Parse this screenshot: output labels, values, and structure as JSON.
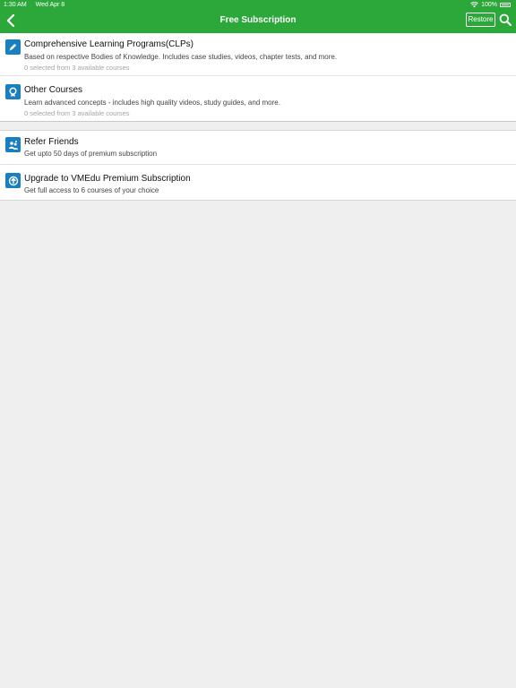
{
  "status_bar": {
    "time": "1:30 AM",
    "date": "Wed Apr 8",
    "battery": "100%"
  },
  "navbar": {
    "title": "Free Subscription",
    "restore_label": "Restore",
    "back_icon": "chevron-left-icon",
    "search_icon": "search-icon"
  },
  "colors": {
    "header": "#2ca83a",
    "icon_bg": "#1a7fc1",
    "background": "#efefef"
  },
  "courses": [
    {
      "title": "Comprehensive Learning Programs(CLPs)",
      "description": "Based on respective Bodies of Knowledge. Includes case studies, videos, chapter tests, and more.",
      "meta": "0 selected from 3 available courses",
      "icon": "pencil-icon"
    },
    {
      "title": "Other Courses",
      "description": "Learn advanced concepts - includes high quality videos, study guides, and more.",
      "meta": "0 selected from 3 available courses",
      "icon": "award-icon"
    }
  ],
  "offers": [
    {
      "title": "Refer Friends",
      "description": "Get upto 50 days of premium subscription",
      "icon": "refer-friends-icon"
    },
    {
      "title": "Upgrade to VMEdu Premium Subscription",
      "description": "Get full access to 6 courses of your choice",
      "icon": "upgrade-icon"
    }
  ]
}
